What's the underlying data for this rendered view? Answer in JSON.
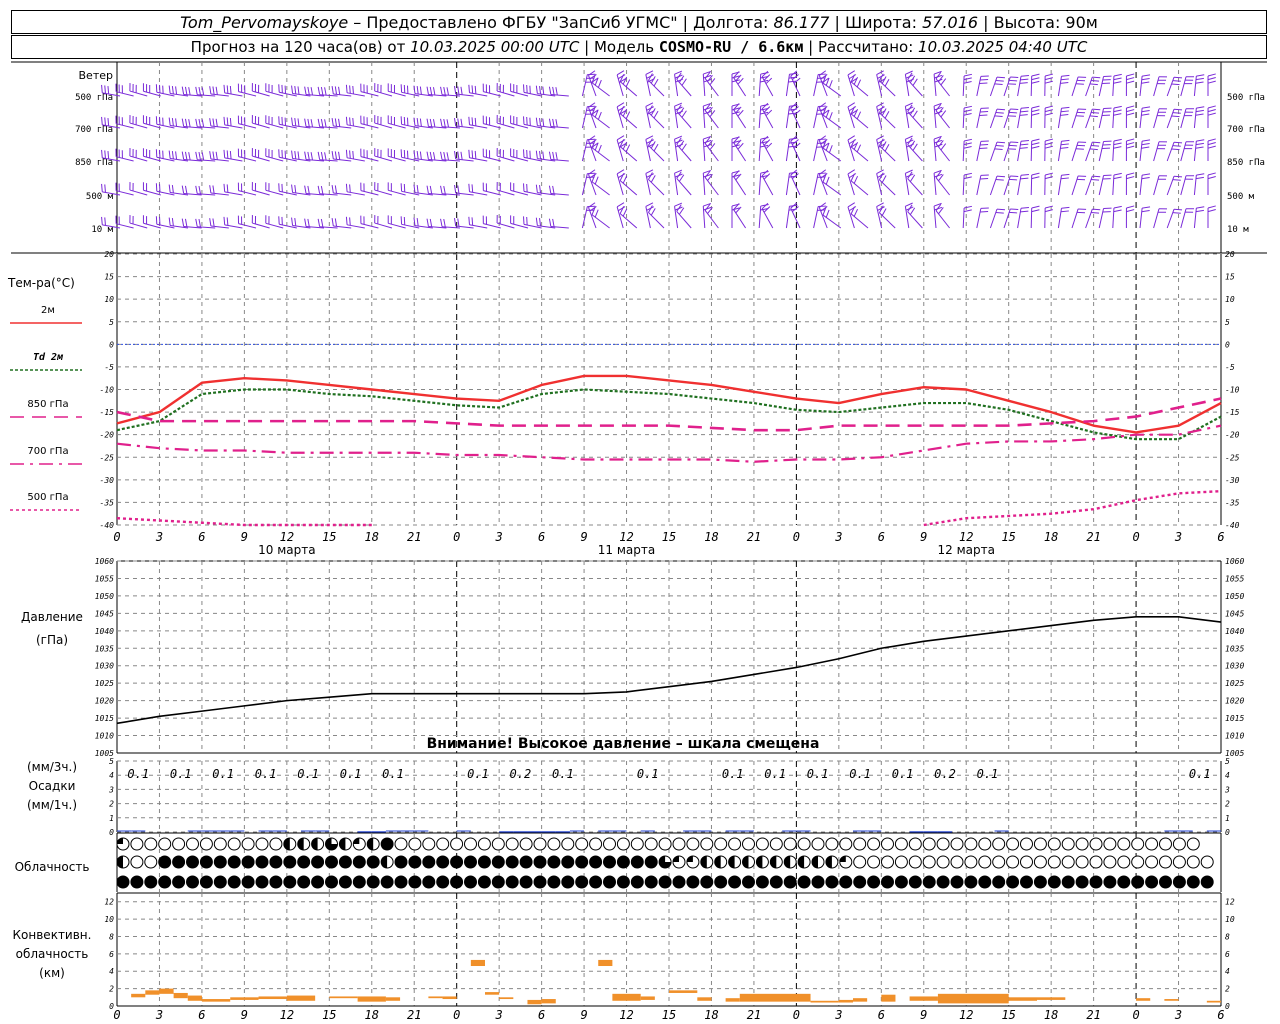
{
  "header": {
    "station": "Tom_Pervomayskoye",
    "provided_by": " – Предоставлено ФГБУ \"ЗапСиб УГМС\" | Долгота: ",
    "lon": "86.177",
    "lat_label": " | Широта: ",
    "lat": "57.016",
    "alt_label": " | Высота: ",
    "alt": "90м",
    "forecast_label": "Прогноз на 120 часа(ов) от ",
    "forecast_from": "10.03.2025 00:00 UTC",
    "model_label": " | Модель ",
    "model": "COSMO-RU / 6.6км",
    "calc_label": " | Рассчитано: ",
    "calc_time": "10.03.2025 04:40 UTC"
  },
  "colors": {
    "t2m": "#f03030",
    "td2m": "#207020",
    "t850": "#e0208c",
    "t700": "#e0208c",
    "t500": "#e0208c",
    "wind": "#7a2ad8",
    "zero_line": "#3050e0",
    "precip": "#2040d0",
    "conv": "#f0902a",
    "grid": "#888888"
  },
  "time_axis": {
    "hour_ticks": [
      "0",
      "3",
      "6",
      "9",
      "12",
      "15",
      "18",
      "21",
      "0",
      "3",
      "6",
      "9",
      "12",
      "15",
      "18",
      "21",
      "0",
      "3",
      "6",
      "9",
      "12",
      "15",
      "18",
      "21",
      "0",
      "3",
      "6"
    ],
    "day_labels": [
      "10 марта",
      "11 марта",
      "12 марта"
    ]
  },
  "chart_data": [
    {
      "id": "wind",
      "type": "barbs",
      "title": "Ветер",
      "levels": [
        "500 гПа",
        "700 гПа",
        "850 гПа",
        "500 м",
        "10 м"
      ]
    },
    {
      "id": "temperature",
      "type": "line",
      "title": "Тем-ра(°C)",
      "ylim": [
        -40,
        20
      ],
      "yticks": [
        20,
        15,
        10,
        5,
        0,
        -5,
        -10,
        -15,
        -20,
        -25,
        -30,
        -35,
        -40
      ],
      "x_hours": [
        0,
        3,
        6,
        9,
        12,
        15,
        18,
        21,
        24,
        27,
        30,
        33,
        36,
        39,
        42,
        45,
        48,
        51,
        54,
        57,
        60,
        63,
        66,
        69,
        72,
        75,
        78
      ],
      "series": [
        {
          "name": "2м",
          "key": "t2m",
          "values": [
            -17.5,
            -15,
            -8.5,
            -7.5,
            -8,
            -9,
            -10,
            -11,
            -12,
            -12.5,
            -9,
            -7,
            -7,
            -8,
            -9,
            -10.5,
            -12,
            -13,
            -11,
            -9.5,
            -10,
            -12.5,
            -15,
            -18,
            -19.5,
            -18,
            -13
          ]
        },
        {
          "name": "Td 2м",
          "key": "td2m",
          "values": [
            -19,
            -17,
            -11,
            -10,
            -10,
            -11,
            -11.5,
            -12.5,
            -13.5,
            -14,
            -11,
            -10,
            -10.5,
            -11,
            -12,
            -13,
            -14.5,
            -15,
            -14,
            -13,
            -13,
            -14.5,
            -17,
            -19.5,
            -21,
            -21,
            -16
          ]
        },
        {
          "name": "850 гПа",
          "key": "t850",
          "values": [
            -15,
            -17,
            -17,
            -17,
            -17,
            -17,
            -17,
            -17,
            -17.5,
            -18,
            -18,
            -18,
            -18,
            -18,
            -18.5,
            -19,
            -19,
            -18,
            -18,
            -18,
            -18,
            -18,
            -17.5,
            -17,
            -16,
            -14,
            -12
          ]
        },
        {
          "name": "700 гПа",
          "key": "t700",
          "values": [
            -22,
            -23,
            -23.5,
            -23.5,
            -24,
            -24,
            -24,
            -24,
            -24.5,
            -24.5,
            -25,
            -25.5,
            -25.5,
            -25.5,
            -25.5,
            -26,
            -25.5,
            -25.5,
            -25,
            -23.5,
            -22,
            -21.5,
            -21.5,
            -21,
            -20,
            -20,
            -18
          ]
        },
        {
          "name": "500 гПа",
          "key": "t500",
          "values": [
            -38.5,
            -39,
            -39.5,
            -40,
            -40,
            -40,
            -40,
            -40.5,
            -41,
            -41,
            -41,
            -41,
            -41,
            -41,
            -41,
            -41,
            -41,
            -41,
            -40.5,
            -40,
            -38.5,
            -38,
            -37.5,
            -36.5,
            -34.5,
            -33,
            -32.5
          ]
        }
      ]
    },
    {
      "id": "pressure",
      "type": "line",
      "title": "Давление",
      "ylabel": "(гПа)",
      "ylim": [
        1005,
        1060
      ],
      "yticks": [
        1060,
        1055,
        1050,
        1045,
        1040,
        1035,
        1030,
        1025,
        1020,
        1015,
        1010,
        1005
      ],
      "x_hours": [
        0,
        3,
        6,
        9,
        12,
        15,
        18,
        21,
        24,
        27,
        30,
        33,
        36,
        39,
        42,
        45,
        48,
        51,
        54,
        57,
        60,
        63,
        66,
        69,
        72,
        75,
        78
      ],
      "values": [
        1013.5,
        1015.5,
        1017,
        1018.5,
        1020,
        1021,
        1022,
        1022,
        1022,
        1022,
        1022,
        1022,
        1022.5,
        1024,
        1025.5,
        1027.5,
        1029.5,
        1032,
        1035,
        1037,
        1038.5,
        1040,
        1041.5,
        1043,
        1044,
        1044,
        1042.5
      ],
      "annotation": "Внимание! Высокое давление – шкала смещена"
    },
    {
      "id": "precip",
      "type": "bar",
      "title": "(мм/3ч.)",
      "subtitle": "Осадки",
      "ylabel": "(мм/1ч.)",
      "ylim": [
        0,
        5
      ],
      "yticks": [
        5,
        4,
        3,
        2,
        1,
        0
      ],
      "labels": [
        {
          "hour": 1.5,
          "text": "0.1"
        },
        {
          "hour": 4.5,
          "text": "0.1"
        },
        {
          "hour": 7.5,
          "text": "0.1"
        },
        {
          "hour": 10.5,
          "text": "0.1"
        },
        {
          "hour": 13.5,
          "text": "0.1"
        },
        {
          "hour": 16.5,
          "text": "0.1"
        },
        {
          "hour": 19.5,
          "text": "0.1"
        },
        {
          "hour": 25.5,
          "text": "0.1"
        },
        {
          "hour": 28.5,
          "text": "0.2"
        },
        {
          "hour": 31.5,
          "text": "0.1"
        },
        {
          "hour": 37.5,
          "text": "0.1"
        },
        {
          "hour": 43.5,
          "text": "0.1"
        },
        {
          "hour": 46.5,
          "text": "0.1"
        },
        {
          "hour": 49.5,
          "text": "0.1"
        },
        {
          "hour": 52.5,
          "text": "0.1"
        },
        {
          "hour": 55.5,
          "text": "0.1"
        },
        {
          "hour": 58.5,
          "text": "0.2"
        },
        {
          "hour": 61.5,
          "text": "0.1"
        },
        {
          "hour": 76.5,
          "text": "0.1"
        }
      ],
      "hourly_mm": [
        [
          17,
          0.05
        ],
        [
          18,
          0.05
        ],
        [
          27,
          0.05
        ],
        [
          28,
          0.05
        ],
        [
          29,
          0.05
        ],
        [
          30,
          0.05
        ],
        [
          31,
          0.05
        ],
        [
          56,
          0.05
        ],
        [
          57,
          0.05
        ],
        [
          58,
          0.05
        ]
      ]
    },
    {
      "id": "cloud",
      "type": "symbols",
      "title": "Облачность",
      "rows": [
        "QEEEEEEEEEEEHHHTHQHFEEEEEEEEEEEEEEEEEEEEEEEEEEEEEEEEEEEEEEEEEEEEEEEEEEEEEEEEEE",
        "HEEFFFFFFFFFFFFFFFFHFFFFFFFFFFFFFFFFFFFTQQHHHHHHHHHHQEEEEEEEEEEEEEEEEEEEEEEEEEEE",
        "FFFFFFFFFFFFFFFFFFFFFFFFFFFFFFFFFFFFFFFFFFFFFFFFFFFFFFFFFFFFFFFFFFFFFFFFFFFFFFFF"
      ]
    },
    {
      "id": "convective",
      "type": "bar",
      "title": "Конвективн.",
      "subtitle": "облачность",
      "ylabel": "(км)",
      "ylim": [
        0,
        13
      ],
      "yticks": [
        12,
        10,
        8,
        6,
        4,
        2,
        0
      ],
      "bars": [
        [
          1,
          2,
          1.0,
          1.4
        ],
        [
          2,
          3,
          1.3,
          1.8
        ],
        [
          3,
          4,
          1.4,
          2.0
        ],
        [
          4,
          5,
          0.9,
          1.5
        ],
        [
          5,
          6,
          0.6,
          1.2
        ],
        [
          6,
          8,
          0.5,
          0.8
        ],
        [
          8,
          10,
          0.7,
          1.0
        ],
        [
          10,
          12,
          0.8,
          1.1
        ],
        [
          12,
          14,
          0.6,
          1.2
        ],
        [
          15,
          17,
          0.9,
          1.1
        ],
        [
          17,
          19,
          0.5,
          1.1
        ],
        [
          19,
          20,
          0.6,
          1.0
        ],
        [
          22,
          23,
          0.9,
          1.1
        ],
        [
          23,
          24,
          0.8,
          1.1
        ],
        [
          25,
          26,
          4.6,
          5.3
        ],
        [
          26,
          27,
          1.3,
          1.6
        ],
        [
          27,
          28,
          0.8,
          1.0
        ],
        [
          29,
          30,
          0.2,
          0.7
        ],
        [
          30,
          31,
          0.3,
          0.8
        ],
        [
          34,
          35,
          4.6,
          5.3
        ],
        [
          35,
          37,
          0.6,
          1.4
        ],
        [
          37,
          38,
          0.7,
          1.1
        ],
        [
          39,
          41,
          1.5,
          1.8
        ],
        [
          41,
          42,
          0.6,
          1.0
        ],
        [
          43,
          44,
          0.5,
          0.9
        ],
        [
          44,
          49,
          0.5,
          1.4
        ],
        [
          49,
          51,
          0.4,
          0.6
        ],
        [
          51,
          52,
          0.4,
          0.7
        ],
        [
          52,
          53,
          0.5,
          0.9
        ],
        [
          54,
          55,
          0.5,
          1.3
        ],
        [
          56,
          58,
          0.6,
          1.1
        ],
        [
          58,
          63,
          0.3,
          1.4
        ],
        [
          63,
          65,
          0.6,
          1.0
        ],
        [
          65,
          67,
          0.7,
          1.0
        ],
        [
          72,
          73,
          0.6,
          0.9
        ],
        [
          74,
          75,
          0.6,
          0.8
        ],
        [
          77,
          78,
          0.4,
          0.6
        ]
      ]
    }
  ]
}
